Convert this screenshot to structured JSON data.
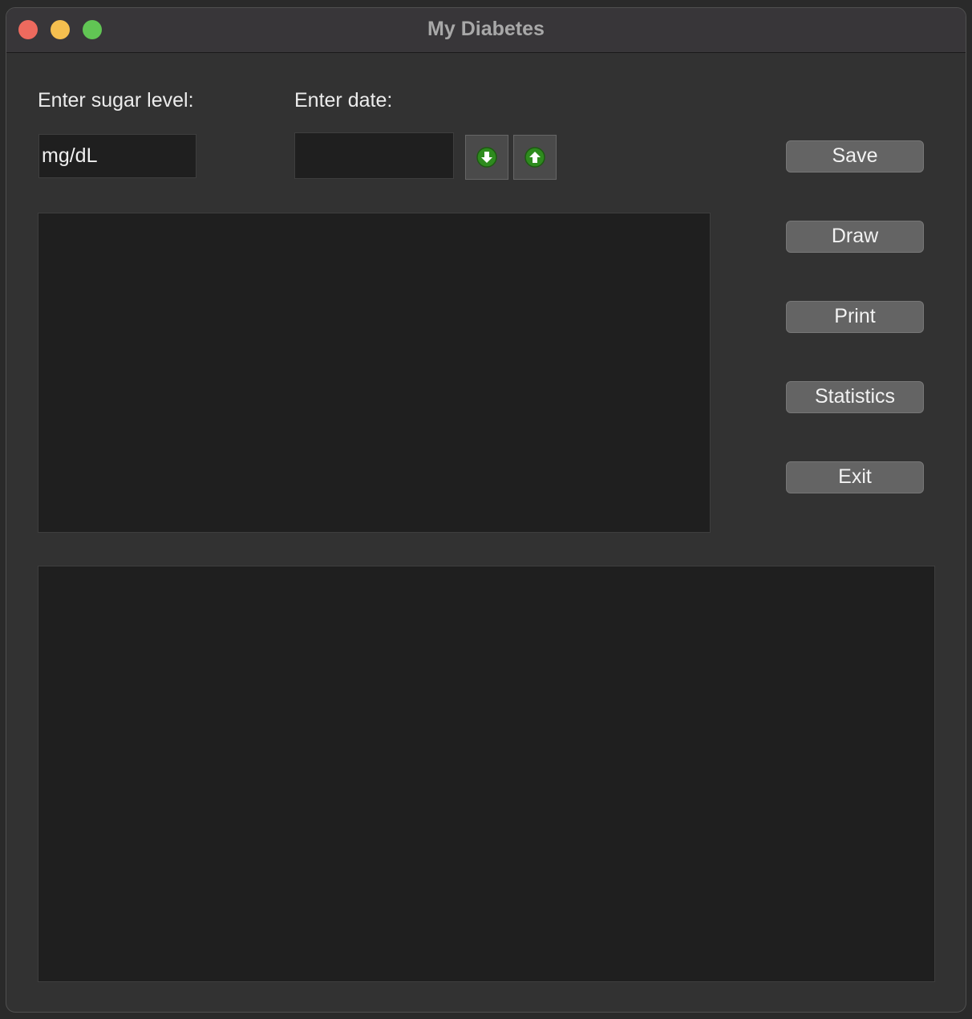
{
  "window": {
    "title": "My Diabetes"
  },
  "form": {
    "sugar_label": "Enter sugar level:",
    "sugar_value": "mg/dL",
    "date_label": "Enter date:",
    "date_value": ""
  },
  "icons": {
    "decrement": "arrow-down-icon",
    "increment": "arrow-up-icon"
  },
  "buttons": {
    "save": "Save",
    "draw": "Draw",
    "print": "Print",
    "statistics": "Statistics",
    "exit": "Exit"
  },
  "colors": {
    "background": "#323232",
    "field": "#1f1f1f",
    "button": "#646464",
    "spin_icon": "#2e8b1e"
  }
}
